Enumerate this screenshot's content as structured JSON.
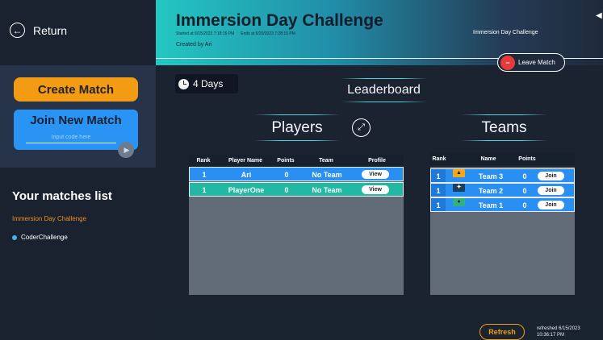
{
  "sidebar": {
    "return_label": "Return",
    "create_label": "Create Match",
    "join_title": "Join New Match",
    "join_placeholder": "Input code here",
    "matches_title": "Your matches list",
    "matches": [
      {
        "label": "Immersion Day Challenge",
        "active": true
      },
      {
        "label": "CoderChallenge",
        "active": false
      }
    ]
  },
  "header": {
    "title": "Immersion Day Challenge",
    "started": "Started at 6/15/2023 7:18:16 PM",
    "ends": "Ends at 6/20/2023 7:28:16 PM",
    "created_by": "Created by Ari",
    "right_label": "Immersion Day Challenge",
    "leave_label": "Leave Match"
  },
  "main": {
    "days_left": "4 Days",
    "leaderboard_title": "Leaderboard",
    "players_title": "Players",
    "teams_title": "Teams"
  },
  "players_table": {
    "columns": [
      "Rank",
      "Player Name",
      "Points",
      "Team",
      "Profile"
    ],
    "rows": [
      {
        "rank": "1",
        "name": "Ari",
        "points": "0",
        "team": "No Team",
        "action": "View"
      },
      {
        "rank": "1",
        "name": "PlayerOne",
        "points": "0",
        "team": "No Team",
        "action": "View"
      }
    ]
  },
  "teams_table": {
    "columns": [
      "Rank",
      "Name",
      "Points"
    ],
    "rows": [
      {
        "rank": "1",
        "name": "Team 3",
        "points": "0",
        "action": "Join",
        "avatar_color": "#f2a81b",
        "avatar_icon": "horse-icon"
      },
      {
        "rank": "1",
        "name": "Team 2",
        "points": "0",
        "action": "Join",
        "avatar_color": "#1d3f5e",
        "avatar_icon": "bird-icon"
      },
      {
        "rank": "1",
        "name": "Team 1",
        "points": "0",
        "action": "Join",
        "avatar_color": "#2fb085",
        "avatar_icon": "fish-icon"
      }
    ]
  },
  "footer": {
    "refresh_label": "Refresh",
    "refreshed_line1": "refreshed 6/15/2023",
    "refreshed_line2": "10:36:17 PM"
  },
  "colors": {
    "accent_orange": "#f39b12",
    "accent_blue": "#2a8ff2",
    "accent_teal": "#22b8a3",
    "danger": "#e83a3a"
  }
}
